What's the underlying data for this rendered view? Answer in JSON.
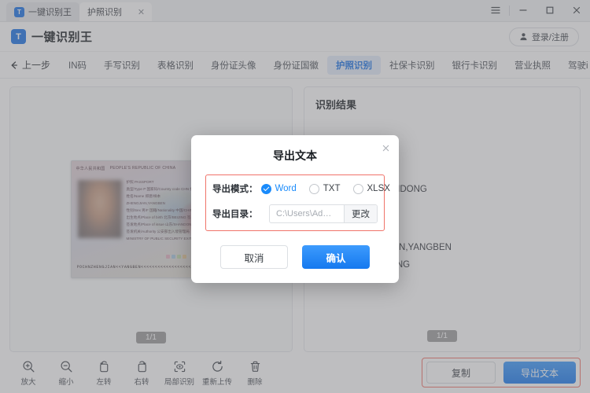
{
  "titlebar": {
    "home_tab": "一键识别王",
    "active_tab": "护照识别",
    "close_icon": "close-icon",
    "menu_icon": "hamburger-menu-icon",
    "minimize_icon": "minimize-icon",
    "maximize_icon": "maximize-icon",
    "close_window_icon": "close-window-icon"
  },
  "header": {
    "brand": "一键识别王",
    "logo_letter": "T",
    "login_label": "登录/注册",
    "user_icon": "user-icon"
  },
  "nav": {
    "back_label": "上一步",
    "back_icon": "arrow-left-icon",
    "items": [
      {
        "label": "IN码",
        "active": false
      },
      {
        "label": "手写识别",
        "active": false
      },
      {
        "label": "表格识别",
        "active": false
      },
      {
        "label": "身份证头像",
        "active": false
      },
      {
        "label": "身份证国徽",
        "active": false
      },
      {
        "label": "护照识别",
        "active": true
      },
      {
        "label": "社保卡识别",
        "active": false
      },
      {
        "label": "银行卡识别",
        "active": false
      },
      {
        "label": "营业执照",
        "active": false
      },
      {
        "label": "驾驶i",
        "active": false
      }
    ],
    "more_icon": "chevron-down-icon"
  },
  "preview": {
    "page_indicator": "1/1",
    "passport": {
      "header_cn": "中华人民共和国",
      "header_en": "PEOPLE'S REPUBLIC OF CHINA",
      "lines": [
        "护照  PASSPORT",
        "类型/Type  P    国家码/Country code  CHN    护照号/Passport No.  E9000",
        "姓名/Name  郑建/样本",
        "ZHENGJIAN,YANGBEN",
        "性别/Sex  男/F    国籍/Nationality  中国/CHINESE    出生日期/Date of birth  03 AUG 1",
        "出生地点/Place of birth  北京/BEIJING    签发日期/Date of issue  16 JUN 20",
        "签发地点/Place of issue  山东/SHANDONG    有效期至/Date of expiry  16 JUN 20",
        "签发机关/Authority  公安部出入境管理局",
        "MINISTRY OF PUBLIC SECURITY EXIT AND ENTRY ADMINISTRATION"
      ],
      "mrz": "POCHNZHENGJIAN<<YANGBEN<<<<<<<<<<<<<<<<<<<<<"
    }
  },
  "results": {
    "title": "识别结果",
    "page_indicator": "1/1",
    "lines": [
      "签发地点:山东/SHANDONG",
      "姓名拼音:ZHENGJIAN,YANGBEN",
      "出生地点:北京/BEIJING"
    ]
  },
  "toolbar": {
    "tools": [
      {
        "label": "放大",
        "icon": "zoom-in-icon"
      },
      {
        "label": "缩小",
        "icon": "zoom-out-icon"
      },
      {
        "label": "左转",
        "icon": "rotate-left-icon"
      },
      {
        "label": "右转",
        "icon": "rotate-right-icon"
      },
      {
        "label": "局部识别",
        "icon": "region-select-icon"
      },
      {
        "label": "重新上传",
        "icon": "refresh-upload-icon"
      },
      {
        "label": "删除",
        "icon": "trash-icon"
      }
    ],
    "copy_label": "复制",
    "export_label": "导出文本",
    "highlight_color": "#f0736a"
  },
  "modal": {
    "title": "导出文本",
    "close_icon": "close-icon",
    "mode_label": "导出模式：",
    "modes": [
      {
        "label": "Word",
        "checked": true
      },
      {
        "label": "TXT",
        "checked": false
      },
      {
        "label": "XLSX",
        "checked": false
      }
    ],
    "dir_label": "导出目录：",
    "dir_value": "C:\\Users\\Administ...",
    "dir_placeholder": "C:\\Users\\Administ...",
    "change_label": "更改",
    "cancel_label": "取消",
    "confirm_label": "确认",
    "highlight_color": "#f0736a",
    "accent_color": "#1a8bfb"
  }
}
